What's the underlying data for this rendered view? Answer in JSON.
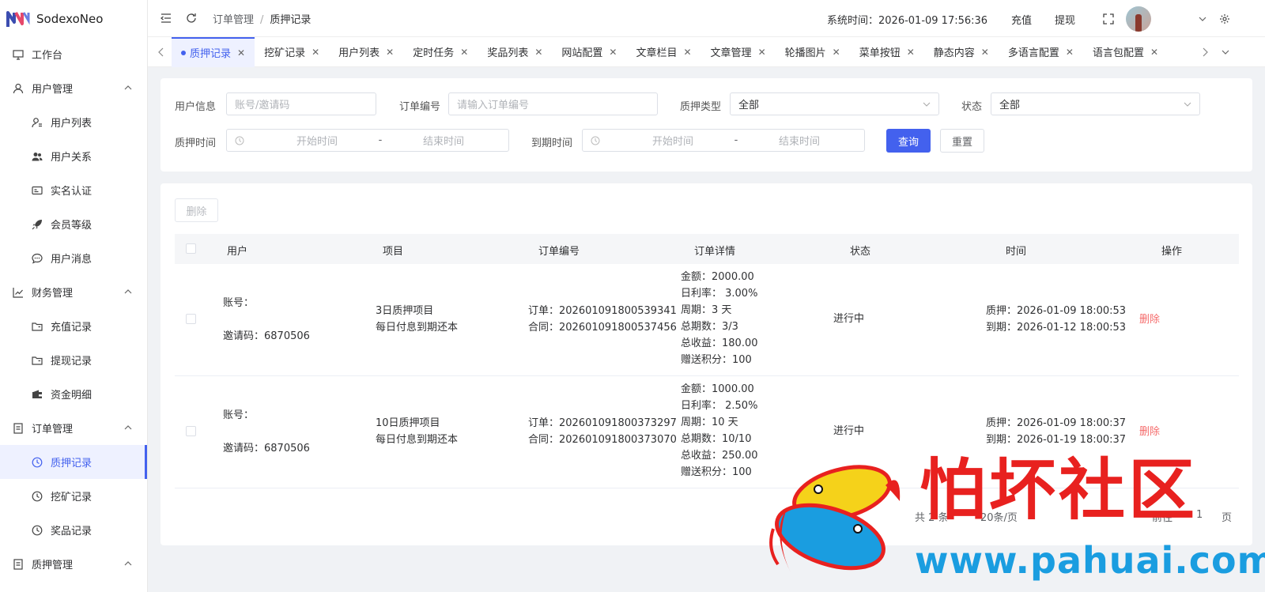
{
  "app": {
    "name": "SodexoNeo"
  },
  "sidebar": {
    "items": [
      {
        "label": "工作台",
        "icon": "monitor-icon",
        "level": 1
      },
      {
        "label": "用户管理",
        "icon": "user-icon",
        "level": 1,
        "expanded": true
      },
      {
        "label": "用户列表",
        "icon": "user-list-icon",
        "level": 2
      },
      {
        "label": "用户关系",
        "icon": "users-icon",
        "level": 2
      },
      {
        "label": "实名认证",
        "icon": "id-card-icon",
        "level": 2
      },
      {
        "label": "会员等级",
        "icon": "rocket-icon",
        "level": 2
      },
      {
        "label": "用户消息",
        "icon": "chat-icon",
        "level": 2
      },
      {
        "label": "财务管理",
        "icon": "chart-icon",
        "level": 1,
        "expanded": true
      },
      {
        "label": "充值记录",
        "icon": "folder-icon",
        "level": 2
      },
      {
        "label": "提现记录",
        "icon": "folder-icon",
        "level": 2
      },
      {
        "label": "资金明细",
        "icon": "wallet-icon",
        "level": 2
      },
      {
        "label": "订单管理",
        "icon": "document-icon",
        "level": 1,
        "expanded": true
      },
      {
        "label": "质押记录",
        "icon": "clock-icon",
        "level": 2,
        "active": true
      },
      {
        "label": "挖矿记录",
        "icon": "clock-icon",
        "level": 2
      },
      {
        "label": "奖品记录",
        "icon": "clock-icon",
        "level": 2
      },
      {
        "label": "质押管理",
        "icon": "document-icon",
        "level": 1,
        "expanded": true
      }
    ]
  },
  "header": {
    "breadcrumb": [
      "订单管理",
      "质押记录"
    ],
    "breadcrumb_sep": "/",
    "system_time": "系统时间：2026-01-09 17:56:36",
    "recharge": "充值",
    "withdraw": "提现"
  },
  "tabs": [
    {
      "label": "质押记录",
      "active": true
    },
    {
      "label": "挖矿记录"
    },
    {
      "label": "用户列表"
    },
    {
      "label": "定时任务"
    },
    {
      "label": "奖品列表"
    },
    {
      "label": "网站配置"
    },
    {
      "label": "文章栏目"
    },
    {
      "label": "文章管理"
    },
    {
      "label": "轮播图片"
    },
    {
      "label": "菜单按钮"
    },
    {
      "label": "静态内容"
    },
    {
      "label": "多语言配置"
    },
    {
      "label": "语言包配置"
    }
  ],
  "filter": {
    "user_label": "用户信息",
    "user_placeholder": "账号/邀请码",
    "order_label": "订单编号",
    "order_placeholder": "请输入订单编号",
    "type_label": "质押类型",
    "type_value": "全部",
    "status_label": "状态",
    "status_value": "全部",
    "pledge_time_label": "质押时间",
    "expire_time_label": "到期时间",
    "start_placeholder": "开始时间",
    "end_placeholder": "结束时间",
    "range_sep": "-",
    "query_button": "查询",
    "reset_button": "重置"
  },
  "table": {
    "delete_button": "删除",
    "columns": [
      "用户",
      "项目",
      "订单编号",
      "订单详情",
      "状态",
      "时间",
      "操作"
    ],
    "rows": [
      {
        "account": "账号：",
        "invite": "邀请码：6870506",
        "project_name": "3日质押项目",
        "project_desc": "每日付息到期还本",
        "order_no": "订单：202601091800539341",
        "contract_no": "合同：202601091800537456",
        "details": [
          "金额：2000.00",
          "日利率： 3.00%",
          "周期：3 天",
          "总期数：3/3",
          "总收益：180.00",
          "赠送积分：100"
        ],
        "status": "进行中",
        "pledge_time": "质押：2026-01-09 18:00:53",
        "expire_time": "到期：2026-01-12 18:00:53",
        "action": "删除"
      },
      {
        "account": "账号：",
        "invite": "邀请码：6870506",
        "project_name": "10日质押项目",
        "project_desc": "每日付息到期还本",
        "order_no": "订单：202601091800373297",
        "contract_no": "合同：202601091800373070",
        "details": [
          "金额：1000.00",
          "日利率： 2.50%",
          "周期：10 天",
          "总期数：10/10",
          "总收益：250.00",
          "赠送积分：100"
        ],
        "status": "进行中",
        "pledge_time": "质押：2026-01-09 18:00:37",
        "expire_time": "到期：2026-01-19 18:00:37",
        "action": "删除"
      }
    ]
  },
  "pagination": {
    "total": "共 2 条",
    "page_size": "20条/页",
    "goto": "前往",
    "page": "1",
    "page_suffix": "页"
  },
  "watermark": {
    "text": "怕坏社区",
    "url": "www.pahuai.com"
  },
  "colors": {
    "primary": "#4361ee",
    "danger": "#f56c6c",
    "watermark_red": "#e8211f",
    "watermark_blue": "#1a9de0"
  }
}
